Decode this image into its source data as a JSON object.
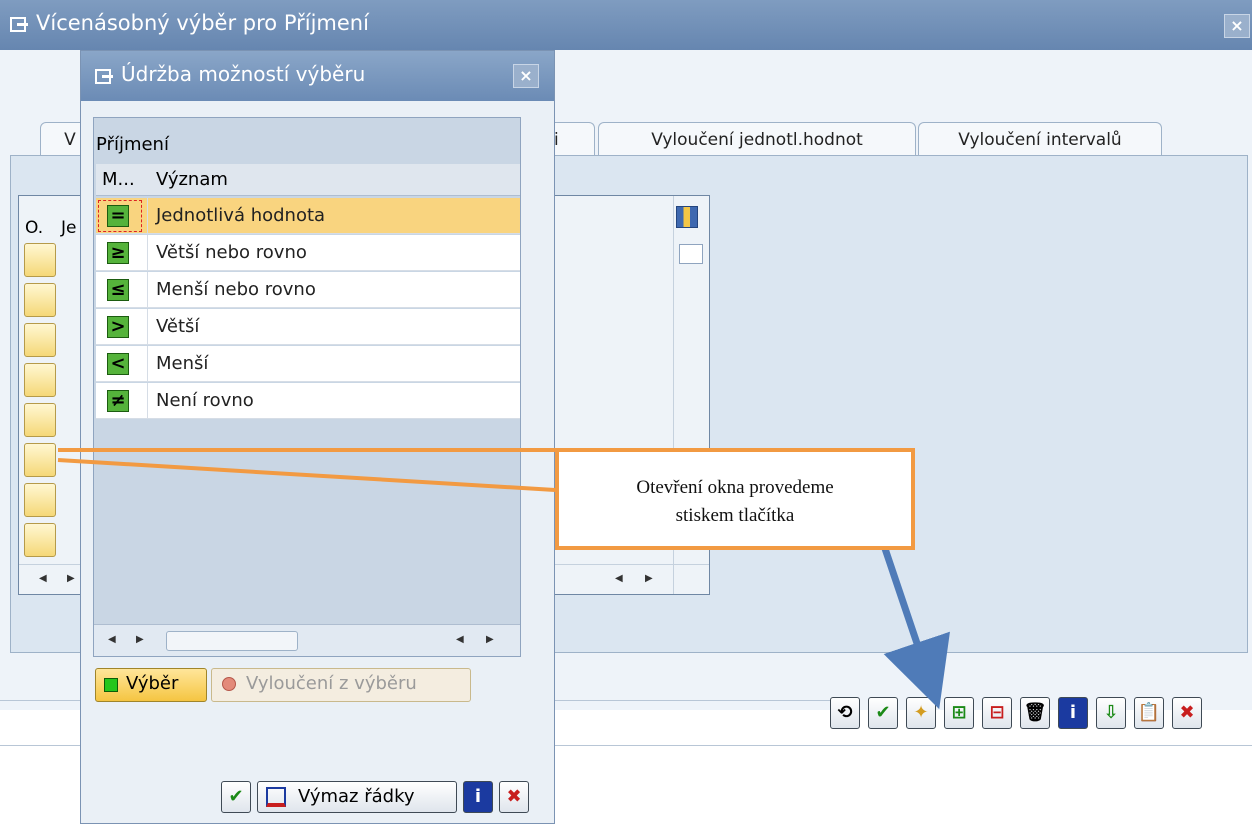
{
  "window": {
    "title": "Vícenásobný výběr pro Příjmení",
    "close": "×"
  },
  "tabs": [
    {
      "label": "V"
    },
    {
      "label": "i"
    },
    {
      "label": "Vyloučení jednotl.hodnot"
    },
    {
      "label": "Vyloučení intervalů"
    }
  ],
  "grid": {
    "col1": "O.",
    "col2": "Je"
  },
  "dialog": {
    "title": "Údržba možností výběru",
    "close": "×",
    "section_label": "Příjmení",
    "col_op": "M...",
    "col_meaning": "Význam",
    "rows": [
      {
        "symbol": "=",
        "label": "Jednotlivá hodnota"
      },
      {
        "symbol": "≥",
        "label": "Větší nebo rovno"
      },
      {
        "symbol": "≤",
        "label": "Menší nebo rovno"
      },
      {
        "symbol": ">",
        "label": "Větší"
      },
      {
        "symbol": "<",
        "label": "Menší"
      },
      {
        "symbol": "≠",
        "label": "Není rovno"
      }
    ],
    "include_label": "Výběr",
    "exclude_label": "Vyloučení z výběru",
    "delete_rows_label": "Výmaz řádky"
  },
  "callout": {
    "line1": "Otevření okna provedeme",
    "line2": "stiskem tlačítka"
  },
  "colors": {
    "accent": "#f29a42",
    "arrow": "#4f7bb8",
    "selected_row": "#f9d47f"
  }
}
